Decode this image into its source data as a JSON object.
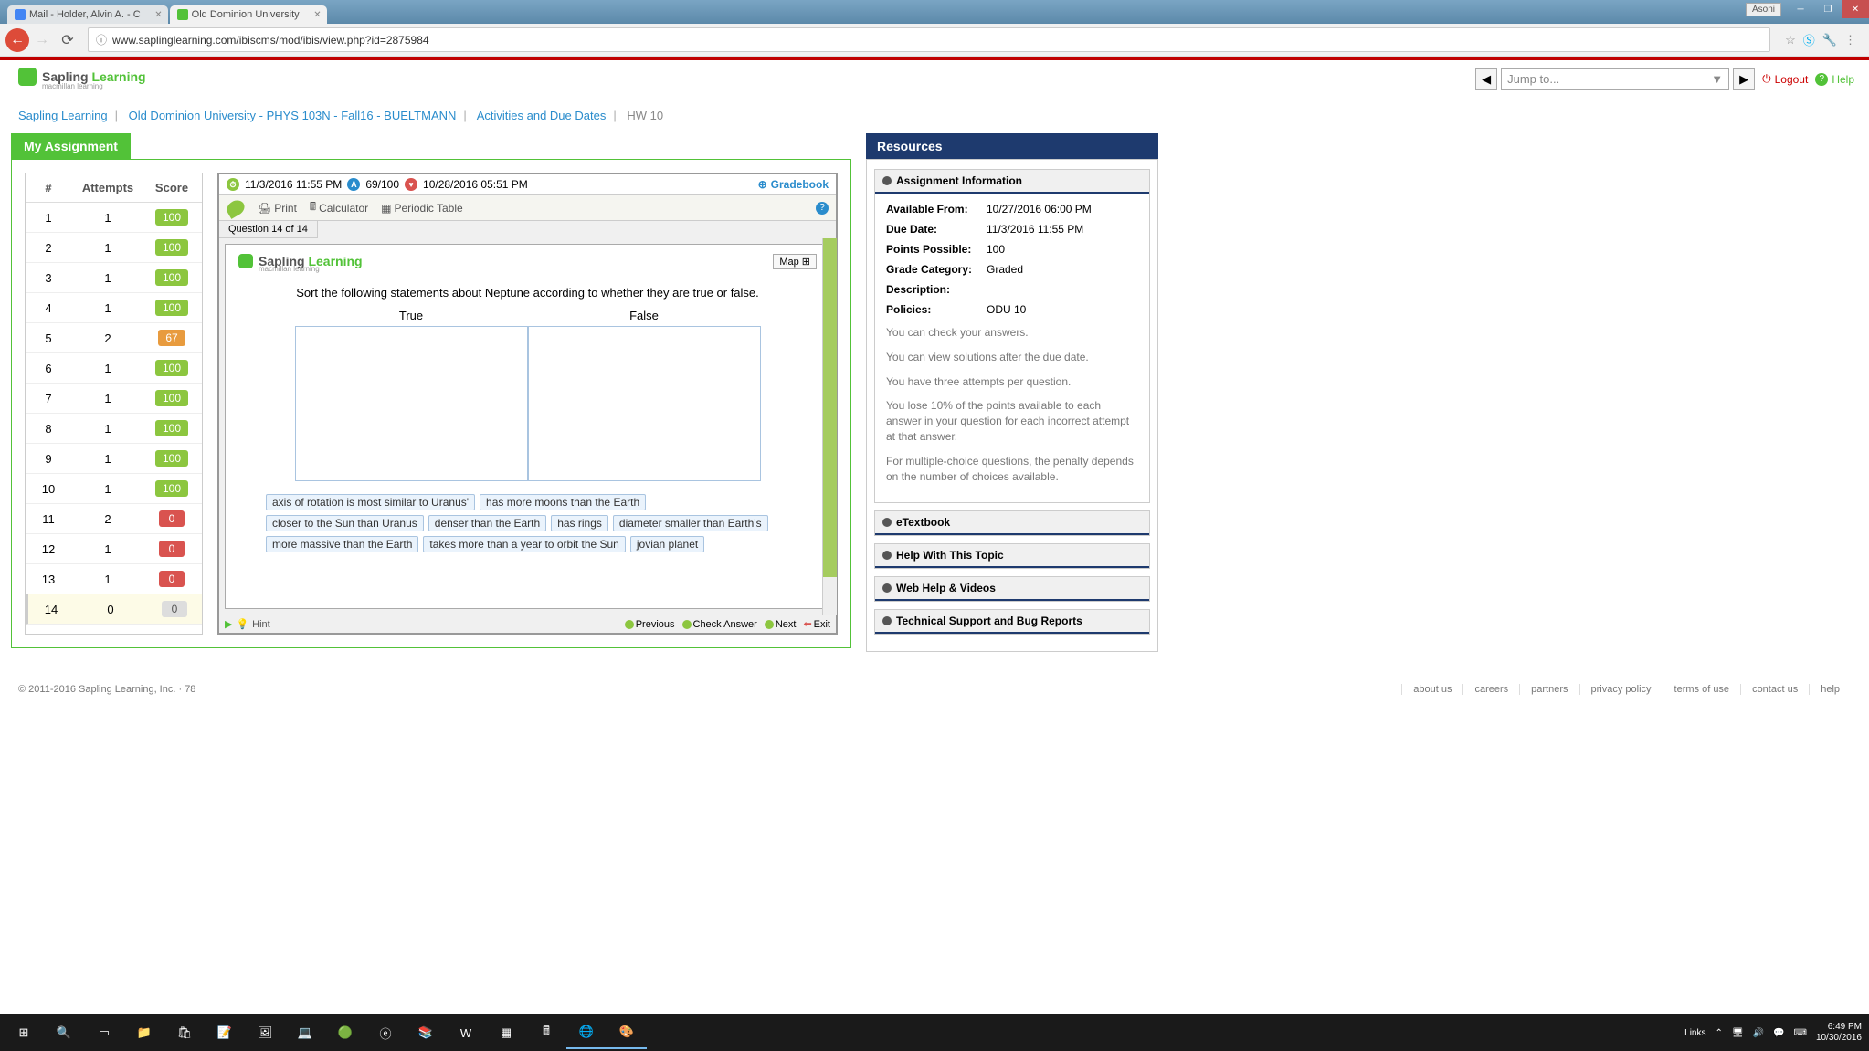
{
  "browser": {
    "tab1": "Mail - Holder, Alvin A. - C",
    "tab2": "Old Dominion University",
    "url": "www.saplinglearning.com/ibiscms/mod/ibis/view.php?id=2875984",
    "asoni": "Asoni"
  },
  "header": {
    "logo_sapling": "Sapling",
    "logo_learning": " Learning",
    "logo_sub": "macmillan learning",
    "jump": "Jump to...",
    "logout": "Logout",
    "help": "Help"
  },
  "breadcrumb": {
    "a": "Sapling Learning",
    "b": "Old Dominion University - PHYS 103N - Fall16 - BUELTMANN",
    "c": "Activities and Due Dates",
    "d": "HW 10"
  },
  "assignment": {
    "title": "My Assignment",
    "col_num": "#",
    "col_att": "Attempts",
    "col_sc": "Score",
    "rows": [
      {
        "n": "1",
        "a": "1",
        "s": "100",
        "cls": "score-100"
      },
      {
        "n": "2",
        "a": "1",
        "s": "100",
        "cls": "score-100"
      },
      {
        "n": "3",
        "a": "1",
        "s": "100",
        "cls": "score-100"
      },
      {
        "n": "4",
        "a": "1",
        "s": "100",
        "cls": "score-100"
      },
      {
        "n": "5",
        "a": "2",
        "s": "67",
        "cls": "score-67"
      },
      {
        "n": "6",
        "a": "1",
        "s": "100",
        "cls": "score-100"
      },
      {
        "n": "7",
        "a": "1",
        "s": "100",
        "cls": "score-100"
      },
      {
        "n": "8",
        "a": "1",
        "s": "100",
        "cls": "score-100"
      },
      {
        "n": "9",
        "a": "1",
        "s": "100",
        "cls": "score-100"
      },
      {
        "n": "10",
        "a": "1",
        "s": "100",
        "cls": "score-100"
      },
      {
        "n": "11",
        "a": "2",
        "s": "0",
        "cls": "score-0"
      },
      {
        "n": "12",
        "a": "1",
        "s": "0",
        "cls": "score-0"
      },
      {
        "n": "13",
        "a": "1",
        "s": "0",
        "cls": "score-0"
      },
      {
        "n": "14",
        "a": "0",
        "s": "0",
        "cls": "score-none"
      }
    ]
  },
  "q": {
    "due": "11/3/2016 11:55 PM",
    "score": "69/100",
    "opened": "10/28/2016 05:51 PM",
    "gradebook": "Gradebook",
    "print": "Print",
    "calc": "Calculator",
    "ptable": "Periodic Table",
    "tab": "Question 14 of 14",
    "map": "Map",
    "prompt": "Sort the following statements about Neptune according to whether they are true or false.",
    "col_true": "True",
    "col_false": "False",
    "s1": "axis of rotation is most similar to Uranus'",
    "s2": "has more moons than the Earth",
    "s3": "closer to the Sun than Uranus",
    "s4": "denser than the Earth",
    "s5": "has rings",
    "s6": "diameter smaller than Earth's",
    "s7": "more massive than the Earth",
    "s8": "takes more than a year to orbit the Sun",
    "s9": "jovian planet",
    "hint": "Hint",
    "prev": "Previous",
    "check": "Check Answer",
    "next": "Next",
    "exit": "Exit"
  },
  "res": {
    "title": "Resources",
    "sec_info": "Assignment Information",
    "avail_l": "Available From:",
    "avail_v": "10/27/2016 06:00 PM",
    "due_l": "Due Date:",
    "due_v": "11/3/2016 11:55 PM",
    "pts_l": "Points Possible:",
    "pts_v": "100",
    "gc_l": "Grade Category:",
    "gc_v": "Graded",
    "desc_l": "Description:",
    "pol_l": "Policies:",
    "pol_v": "ODU 10",
    "n1": "You can check your answers.",
    "n2": "You can view solutions after the due date.",
    "n3": "You have three attempts per question.",
    "n4": "You lose 10% of the points available to each answer in your question for each incorrect attempt at that answer.",
    "n5": "For multiple-choice questions, the penalty depends on the number of choices available.",
    "sec_ebook": "eTextbook",
    "sec_help": "Help With This Topic",
    "sec_web": "Web Help & Videos",
    "sec_tech": "Technical Support and Bug Reports"
  },
  "footer": {
    "copy": "© 2011-2016 Sapling Learning, Inc. · 78",
    "about": "about us",
    "careers": "careers",
    "partners": "partners",
    "privacy": "privacy policy",
    "terms": "terms of use",
    "contact": "contact us",
    "help": "help"
  },
  "task": {
    "links": "Links",
    "time": "6:49 PM",
    "date": "10/30/2016"
  }
}
